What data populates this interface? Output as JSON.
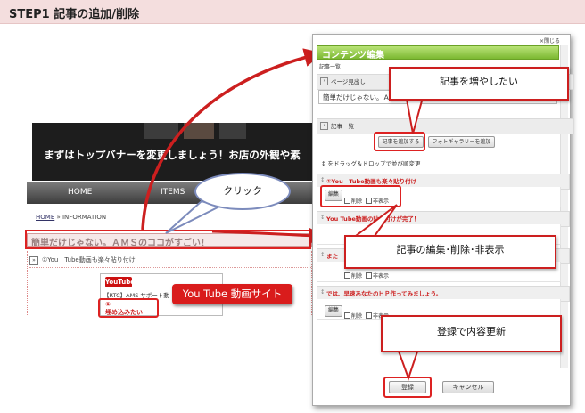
{
  "step": {
    "title": "STEP1 記事の追加/削除"
  },
  "site": {
    "banner_text": "まずはトップバナーを変更しましょう！お店の外観や素",
    "nav": {
      "home": "HOME",
      "items": "ITEMS"
    },
    "breadcrumb": {
      "home": "HOME",
      "sep": "» INFORMATION"
    },
    "page_title": "簡単だけじゃない。ＡＭＳのココがすごい！",
    "content_marker": "»",
    "content_line": "①You　Tube動画も楽々貼り付け",
    "youtube_logo": "YouTube",
    "youtube_line": "【RTC】AMS サポート動",
    "youtube_box": "①\n埋め込みたい",
    "youtube_badge": "You Tube 動画サイト"
  },
  "panel": {
    "close_label": "×閉じる",
    "title": "コンテンツ編集",
    "small_label": "記事一覧",
    "page_heading_label": "ページ見出し",
    "page_heading_value": "簡単だけじゃない。ＡＭＳ",
    "article_list_label": "記事一覧",
    "add_article_button": "記事を追加する",
    "photo_gallery_button": "フォトギャラリーを追加",
    "drag_note": "をドラッグ＆ドロップで並び順変更",
    "items": [
      {
        "title": "①You　Tube動画も楽々貼り付け",
        "edit": "編集",
        "delete": "削除",
        "hide": "非表示"
      },
      {
        "title": "You Tube動画の貼り付けが完了！",
        "edit": "編集",
        "delete": "削除",
        "hide": "非表示"
      },
      {
        "title": "また",
        "edit": "編集",
        "delete": "削除",
        "hide": "非表示"
      },
      {
        "title": "では、早速あなたのＨＰ作ってみましょう。",
        "edit": "編集",
        "delete": "削除",
        "hide": "非表示"
      }
    ],
    "register_button": "登録",
    "cancel_button": "キャンセル"
  },
  "callouts": {
    "add": "記事を増やしたい",
    "edit": "記事の編集･削除･非表示",
    "register": "登録で内容更新",
    "click": "クリック"
  },
  "colors": {
    "accent_red": "#cc1f1f",
    "panel_green": "#7cb832",
    "header_pink": "#f4dede"
  }
}
